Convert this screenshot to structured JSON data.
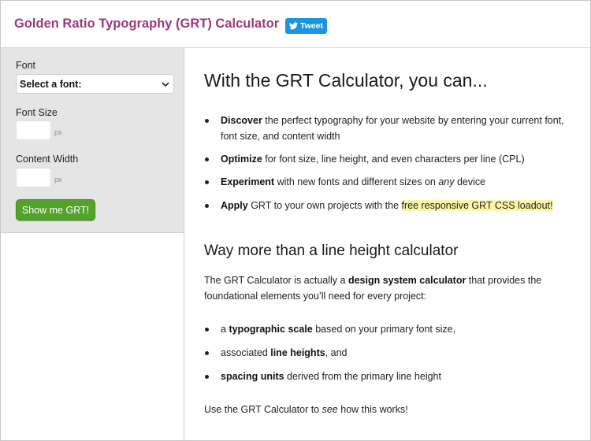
{
  "header": {
    "title": "Golden Ratio Typography (GRT) Calculator",
    "tweet_label": "Tweet",
    "tweet_color": "#1b95e0",
    "title_color": "#9b3a7c"
  },
  "sidebar": {
    "font_label": "Font",
    "font_select_value": "Select a font:",
    "font_size_label": "Font Size",
    "font_size_value": "",
    "font_size_unit": "px",
    "content_width_label": "Content Width",
    "content_width_value": "",
    "content_width_unit": "px",
    "submit_label": "Show me GRT!",
    "submit_color": "#53a32a"
  },
  "main": {
    "heading1": "With the GRT Calculator, you can...",
    "features": [
      {
        "strong": "Discover",
        "text": " the perfect typography for your website by entering your current font, font size, and content width"
      },
      {
        "strong": "Optimize",
        "text": " for font size, line height, and even characters per line (CPL)"
      },
      {
        "strong": "Experiment",
        "text": " with new fonts and different sizes on ",
        "em": "any",
        "text2": " device"
      },
      {
        "strong": "Apply",
        "text": " GRT to your own projects with the ",
        "link": "free responsive GRT CSS loadout!"
      }
    ],
    "heading2": "Way more than a line height calculator",
    "intro": {
      "pre": "The GRT Calculator is actually a ",
      "strong": "design system calculator",
      "post": " that provides the foundational elements you’ll need for every project:"
    },
    "elements": [
      {
        "pre": "a ",
        "strong": "typographic scale",
        "post": " based on your primary font size,"
      },
      {
        "pre": "associated ",
        "strong": "line heights",
        "post": ", and"
      },
      {
        "pre": "",
        "strong": "spacing units",
        "post": " derived from the primary line height"
      }
    ],
    "closing": {
      "pre": "Use the GRT Calculator to ",
      "em": "see",
      "post": " how this works!"
    },
    "highlight_color": "#fcf5a9"
  }
}
